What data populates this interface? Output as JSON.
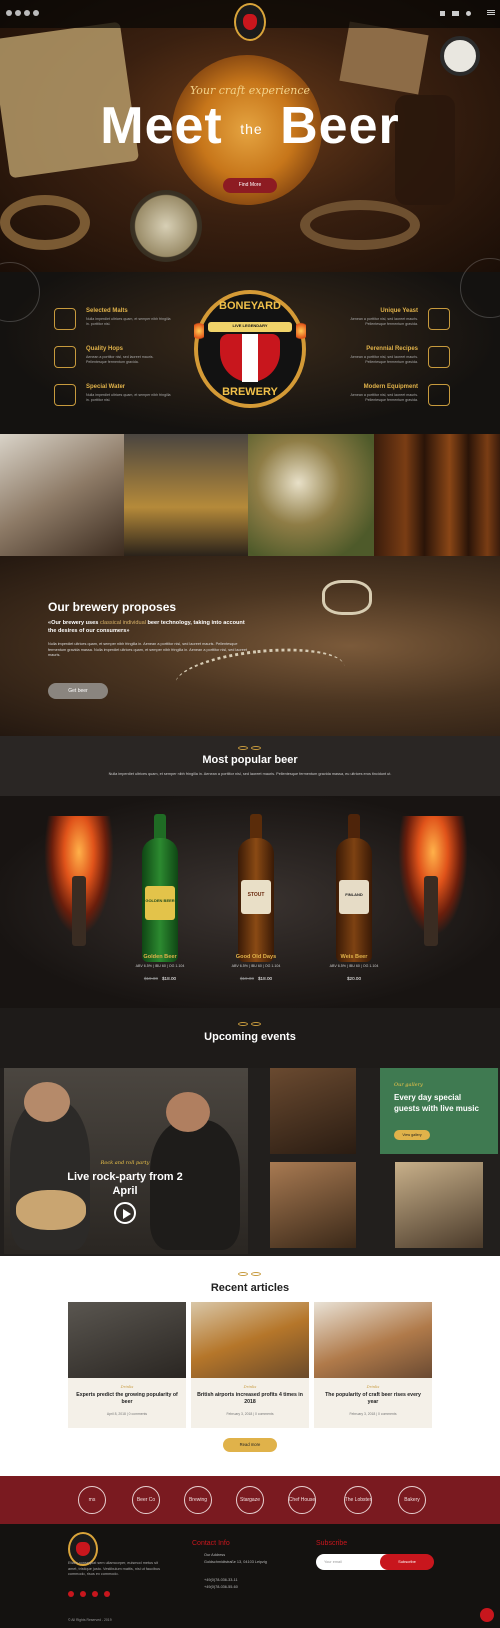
{
  "hero": {
    "subtitle": "Your craft experience",
    "title_left": "Meet",
    "title_mid": "the",
    "title_right": "Beer",
    "button": "Find More"
  },
  "features": {
    "left": [
      {
        "title": "Selected Malts",
        "text": "Nulla imperdiet ultrices quam, et semper nibh fringilla in. porttitor nisl."
      },
      {
        "title": "Quality Hops",
        "text": "Aenean a porttitor nisl, sed laoreet mauris. Pellentesque fermentum gravida."
      },
      {
        "title": "Special Water",
        "text": "Nulla imperdiet ultrices quam, et semper nibh fringilla in. porttitor nisl."
      }
    ],
    "right": [
      {
        "title": "Unique Yeast",
        "text": "Aenean a porttitor nisl, sed laoreet mauris. Pellentesque fermentum gravida."
      },
      {
        "title": "Perennial Recipes",
        "text": "Aenean a porttitor nisl, sed laoreet mauris. Pellentesque fermentum gravida."
      },
      {
        "title": "Modern Equipment",
        "text": "Aenean a porttitor nisl, sed laoreet mauris. Pellentesque fermentum gravida."
      }
    ],
    "logo_top": "BONEYARD",
    "logo_band": "LIVE LEGENDARY",
    "logo_bottom": "BREWERY"
  },
  "proposes": {
    "title": "Our brewery proposes",
    "lead_1": "«Our brewery uses",
    "lead_hl": "classical individual",
    "lead_2": "beer technology, taking into account the desires of our consumers»",
    "body": "Nulla imperdiet ultrices quam, et semper nibh fringilla in. Aenean a porttitor nisl, sed laoreet mauris. Pellentesque fermentum gravida massa. Nulla imperdiet ultrices quam, et semper nibh fringilla in. Aenean a porttitor nisl, sed laoreet mauris.",
    "button": "Get beer"
  },
  "popular": {
    "title": "Most popular beer",
    "text": "Nulla imperdiet ultrices quam, et semper nibh fringilla in. Aenean a porttitor nisl, sed laoreet mauris. Pellentesque fermentum gravida massa, eu ultrices eros tincidunt ut.",
    "beers": [
      {
        "name": "Golden Beer",
        "spec": "ABV 6.5% | IBU 60 | OG 1.104",
        "old": "$19.00",
        "price": "$18.00",
        "label": "GOLDEN BEER"
      },
      {
        "name": "Good Old Days",
        "spec": "ABV 6.5% | IBU 60 | OG 1.104",
        "old": "$19.00",
        "price": "$18.00",
        "label": "STOUT"
      },
      {
        "name": "Weis Beer",
        "spec": "ABV 6.5% | IBU 60 | OG 1.104",
        "old": "",
        "price": "$20.00",
        "label": "FINLAND"
      }
    ]
  },
  "events": {
    "title": "Upcoming events",
    "big_script": "Rock and roll party",
    "big_title": "Live rock-party from 2 April",
    "green_script": "Our gallery",
    "green_title": "Every day special guests with live music",
    "green_button": "View gallery"
  },
  "articles": {
    "title": "Recent articles",
    "items": [
      {
        "cat": "Drinks",
        "title": "Experts predict the growing popularity of beer",
        "meta": "April 8, 2018   |   0 comments"
      },
      {
        "cat": "Drinks",
        "title": "British airports increased profits 4 times in 2018",
        "meta": "February 3, 2018   |   0 comments"
      },
      {
        "cat": "Drinks",
        "title": "The popularity of craft beer rises every year",
        "meta": "February 3, 2018   |   0 comments"
      }
    ],
    "button": "Read more"
  },
  "brands": [
    "ms",
    "Beer Co",
    "Brewing",
    "Stargaze",
    "Chef House",
    "The Lobster",
    "Bakery"
  ],
  "footer": {
    "about": "Etiam consequat sem ullamcorper, euismod metus sit amet, tristique justo. Vestibulum mattis, nisi ut faucibus commodo, risus ex commodo.",
    "contact_title": "Contact Info",
    "address_label": "Our Address",
    "address": "Goldschmidtstraße 13, 04103 Leipzig",
    "phone1": "+49(0)78-036-33-11",
    "phone2": "+49(0)78-036-55-60",
    "subscribe_title": "Subscribe",
    "email_placeholder": "Your email",
    "subscribe_button": "Subscribe",
    "copyright": "© All Rights Reserved - 2019"
  },
  "colors": {
    "accent": "#c8161d",
    "gold": "#e0b24a",
    "green": "#3f7a51",
    "brand_bar": "#7a1a20"
  }
}
